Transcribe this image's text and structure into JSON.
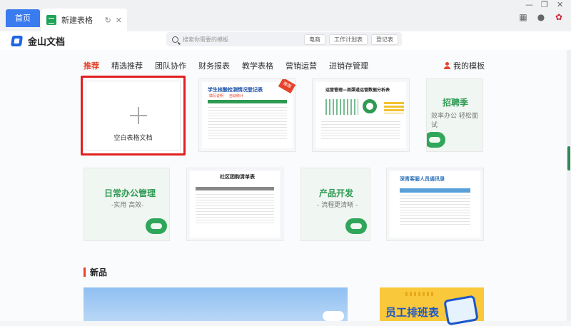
{
  "tabbar": {
    "home_tab": "首页",
    "doc_tab": "新建表格"
  },
  "header": {
    "app_name": "金山文档",
    "search_placeholder": "搜索你需要的模板",
    "search_chips": [
      "电商",
      "工作计划表",
      "登记表"
    ]
  },
  "categories": [
    "推荐",
    "精选推荐",
    "团队协作",
    "财务报表",
    "教学表格",
    "营销运营",
    "进销存管理"
  ],
  "my_templates": "我的模板",
  "blank_card": {
    "label": "空白表格文档"
  },
  "templates_row1": [
    {
      "title": "学生核酸检测情况登记表",
      "badge": "推荐",
      "subtitle1": "填写说明",
      "subtitle2": "自动统计"
    },
    {
      "title": "运营管理—周渠道运营数据分析表"
    },
    {
      "title": "招聘季",
      "subtitle": "效率办公 轻松面试"
    }
  ],
  "templates_row2": [
    {
      "title": "日常办公管理",
      "subtitle": "-实用 高效-"
    },
    {
      "title": "社区团购清单表"
    },
    {
      "title": "产品开发",
      "subtitle": "- 流程更清晰 -"
    },
    {
      "title": "深青客服人员通讯录"
    }
  ],
  "new_section": {
    "heading": "新品",
    "staff_card_title": "员工排班表"
  },
  "colors": {
    "accent_red": "#e5432a",
    "brand_blue": "#3a7bf0",
    "green": "#2fa65a",
    "highlight_border": "#e02020"
  }
}
